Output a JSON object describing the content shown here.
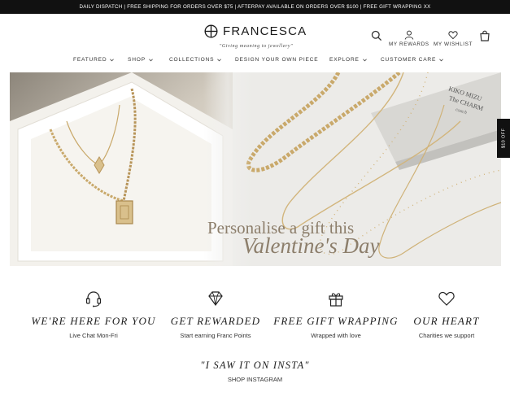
{
  "announcement": "DAILY DISPATCH | FREE SHIPPING FOR ORDERS OVER $75 | AFTERPAY AVAILABLE ON ORDERS OVER $100 | FREE GIFT WRAPPING XX",
  "brand": {
    "name": "FRANCESCA",
    "tagline": "\"Giving meaning to jewellery\""
  },
  "utility": {
    "search_icon": "search-icon",
    "rewards_label": "MY REWARDS",
    "wishlist_label": "MY WISHLIST",
    "cart_icon": "bag-icon"
  },
  "nav": {
    "items": [
      {
        "label": "FEATURED",
        "caret": true
      },
      {
        "label": "SHOP",
        "caret": true
      },
      {
        "label": "COLLECTIONS",
        "caret": true
      },
      {
        "label": "DESIGN YOUR OWN PIECE",
        "caret": false
      },
      {
        "label": "EXPLORE",
        "caret": true
      },
      {
        "label": "CUSTOMER CARE",
        "caret": true
      }
    ]
  },
  "hero": {
    "title_line1": "Personalise a gift this",
    "title_line2": "Valentine's Day",
    "card_text": [
      "KIKO MIZU",
      "The CHARM",
      "coach"
    ]
  },
  "side_tab": "$10 OFF",
  "features": [
    {
      "icon": "headset-icon",
      "title": "WE'RE HERE FOR YOU",
      "subtitle": "Live Chat Mon-Fri"
    },
    {
      "icon": "diamond-icon",
      "title": "GET REWARDED",
      "subtitle": "Start earning Franc Points"
    },
    {
      "icon": "gift-icon",
      "title": "FREE GIFT WRAPPING",
      "subtitle": "Wrapped with love"
    },
    {
      "icon": "heart-icon",
      "title": "OUR HEART",
      "subtitle": "Charities we support"
    }
  ],
  "instagram": {
    "title": "\"I SAW IT ON INSTA\"",
    "link": "SHOP INSTAGRAM"
  },
  "colors": {
    "announcement_bg": "#111111",
    "hero_text": "#8c7e6b",
    "gold": "#c9a96b"
  }
}
